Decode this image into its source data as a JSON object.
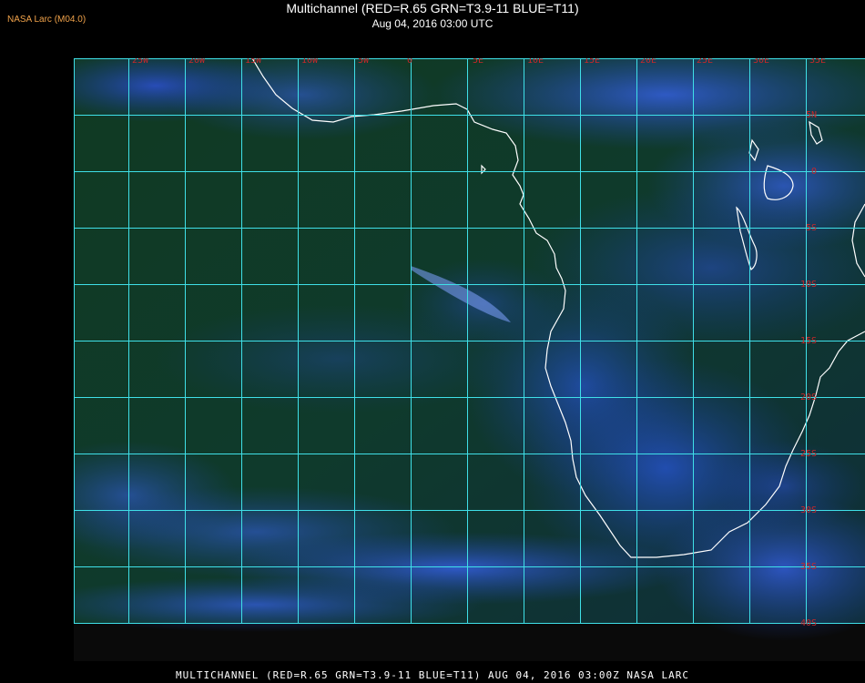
{
  "credit": "NASA Larc (M04.0)",
  "title": "Multichannel (RED=R.65 GRN=T3.9-11 BLUE=T11)",
  "subtitle": "Aug 04, 2016 03:00 UTC",
  "footer": "MULTICHANNEL (RED=R.65 GRN=T3.9-11 BLUE=T11) AUG 04, 2016 03:00Z   NASA LARC",
  "colors": {
    "grid": "#3fe0e8",
    "coast": "#ffffff",
    "gridlabel": "#c8282a",
    "ocean_dark": "#0e3a1c",
    "cloud_blue": "#2a55d8",
    "cloud_bright": "#5a88ff"
  },
  "longitude_labels": [
    "25W",
    "20W",
    "15W",
    "10W",
    "5W",
    "0",
    "5E",
    "10E",
    "15E",
    "20E",
    "25E",
    "30E",
    "35E"
  ],
  "latitude_labels": [
    "5N",
    "0",
    "5S",
    "10S",
    "15S",
    "20S",
    "25S",
    "30S",
    "35S",
    "40S"
  ]
}
